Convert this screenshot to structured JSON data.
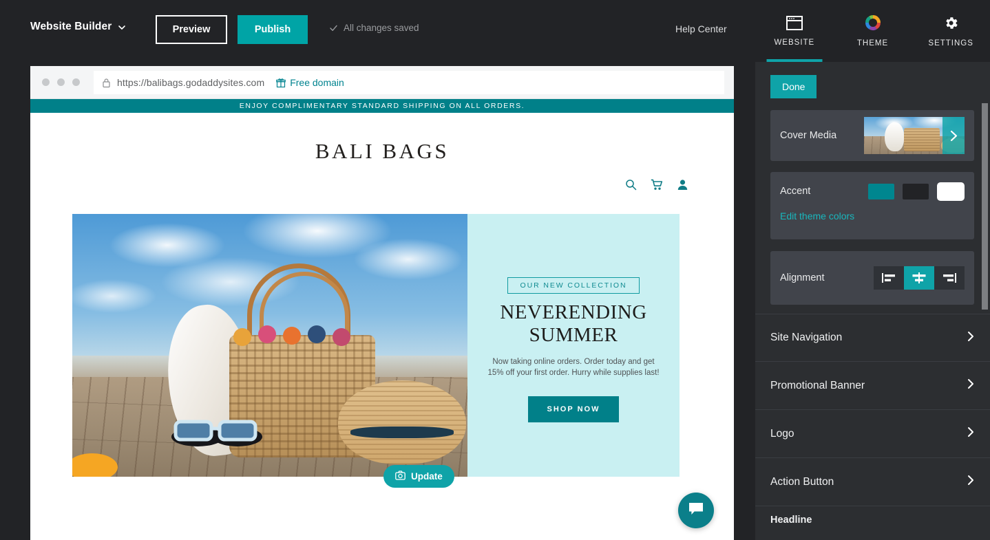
{
  "topbar": {
    "brand": "Website Builder",
    "brand_caret_icon": "chevron-down-icon",
    "preview_label": "Preview",
    "publish_label": "Publish",
    "saved_status": "All changes saved",
    "saved_icon": "check-icon",
    "help_label": "Help Center"
  },
  "browser": {
    "lock_icon": "lock-icon",
    "url": "https://balibags.godaddysites.com",
    "free_domain_label": "Free domain",
    "free_domain_icon": "gift-icon"
  },
  "site": {
    "promo_banner": "ENJOY COMPLIMENTARY STANDARD SHIPPING ON ALL ORDERS.",
    "logo": "BALI BAGS",
    "header_icons": [
      "search-icon",
      "cart-icon",
      "account-icon"
    ],
    "hero": {
      "eyebrow": "OUR NEW COLLECTION",
      "headline_line1": "NEVERENDING",
      "headline_line2": "SUMMER",
      "subtext_line1": "Now taking online orders. Order today and get",
      "subtext_line2": "15% off your first order. Hurry while supplies last!",
      "cta": "SHOP NOW"
    },
    "update_button": "Update",
    "update_icon": "camera-icon",
    "chat_icon": "chat-bubble-icon"
  },
  "panel": {
    "tabs": [
      {
        "label": "WEBSITE",
        "icon": "browser-window-icon",
        "active": true
      },
      {
        "label": "THEME",
        "icon": "color-wheel-icon",
        "active": false
      },
      {
        "label": "SETTINGS",
        "icon": "gear-icon",
        "active": false
      }
    ],
    "done_label": "Done",
    "cover_media": {
      "label": "Cover Media",
      "chevron_icon": "chevron-right-icon"
    },
    "accent": {
      "label": "Accent",
      "swatches": [
        "#00868f",
        "#222326",
        "#ffffff"
      ],
      "selected_index": 2,
      "edit_link": "Edit theme colors"
    },
    "alignment": {
      "label": "Alignment",
      "options": [
        "align-left-icon",
        "align-center-icon",
        "align-right-icon"
      ],
      "selected_index": 1
    },
    "sections": [
      {
        "label": "Site Navigation",
        "chevron_icon": "chevron-right-icon"
      },
      {
        "label": "Promotional Banner",
        "chevron_icon": "chevron-right-icon"
      },
      {
        "label": "Logo",
        "chevron_icon": "chevron-right-icon"
      },
      {
        "label": "Action Button",
        "chevron_icon": "chevron-right-icon"
      }
    ],
    "partial_section": "Headline"
  },
  "colors": {
    "accent_teal": "#0fa3a8",
    "deep_teal": "#018089",
    "panel_bg": "#2c2e31",
    "card_bg": "#41444b",
    "topbar_bg": "#222326",
    "hero_panel": "#c9f0f2"
  }
}
